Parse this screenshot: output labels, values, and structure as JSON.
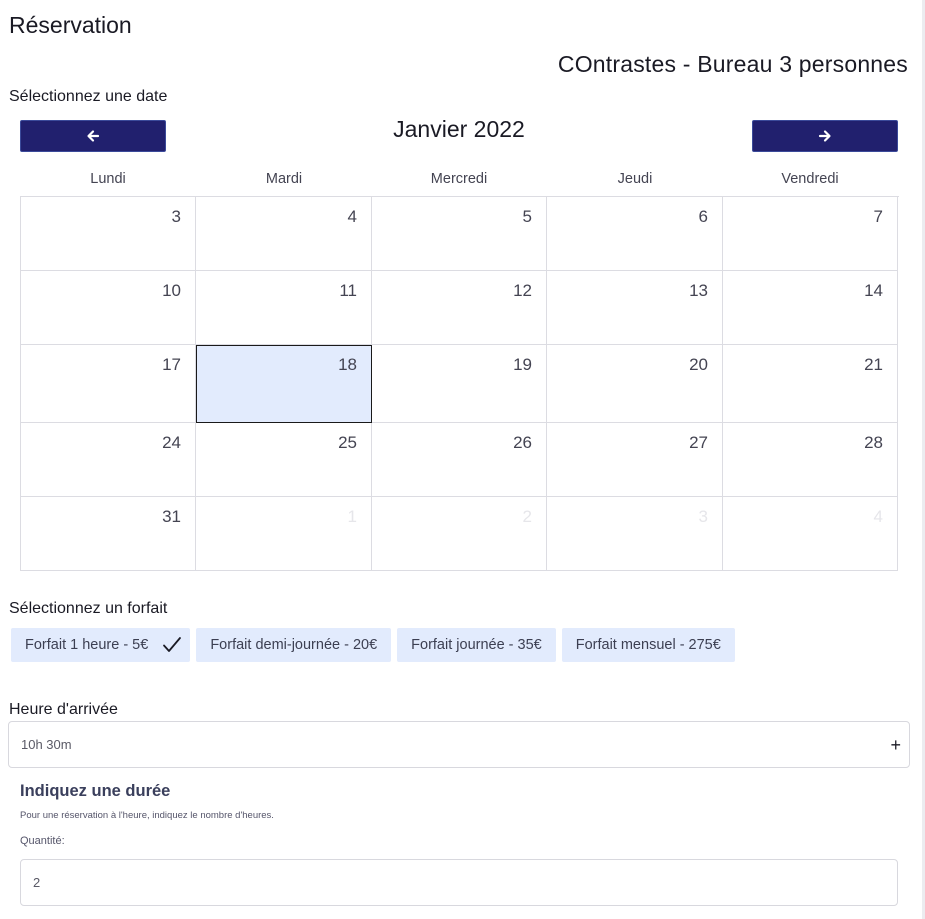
{
  "page": {
    "title": "Réservation",
    "space_name": "COntrastes - Bureau 3 personnes"
  },
  "date_section": {
    "label": "Sélectionnez une date",
    "month_label": "Janvier 2022",
    "prev_icon": "arrow-left-icon",
    "next_icon": "arrow-right-icon",
    "weekdays": [
      "Lundi",
      "Mardi",
      "Mercredi",
      "Jeudi",
      "Vendredi"
    ],
    "selected_day": "18",
    "weeks": [
      {
        "days": [
          {
            "num": "3"
          },
          {
            "num": "4"
          },
          {
            "num": "5"
          },
          {
            "num": "6"
          },
          {
            "num": "7"
          }
        ]
      },
      {
        "days": [
          {
            "num": "10"
          },
          {
            "num": "11"
          },
          {
            "num": "12"
          },
          {
            "num": "13"
          },
          {
            "num": "14"
          }
        ]
      },
      {
        "days": [
          {
            "num": "17"
          },
          {
            "num": "18"
          },
          {
            "num": "19"
          },
          {
            "num": "20"
          },
          {
            "num": "21"
          }
        ]
      },
      {
        "days": [
          {
            "num": "24"
          },
          {
            "num": "25"
          },
          {
            "num": "26"
          },
          {
            "num": "27"
          },
          {
            "num": "28"
          }
        ]
      },
      {
        "days": [
          {
            "num": "31"
          },
          {
            "num": "1",
            "muted": true
          },
          {
            "num": "2",
            "muted": true
          },
          {
            "num": "3",
            "muted": true
          },
          {
            "num": "4",
            "muted": true
          }
        ]
      }
    ]
  },
  "plan_section": {
    "label": "Sélectionnez un forfait",
    "selected_index": 0,
    "plans": [
      {
        "label": "Forfait 1 heure - 5€"
      },
      {
        "label": "Forfait demi-journée - 20€"
      },
      {
        "label": "Forfait journée - 35€"
      },
      {
        "label": "Forfait mensuel - 275€"
      }
    ]
  },
  "arrival": {
    "label": "Heure d'arrivée",
    "value": "10h 30m",
    "expand_symbol": "+"
  },
  "duration": {
    "title": "Indiquez une durée",
    "help": "Pour une réservation à l'heure, indiquez le nombre d'heures.",
    "quantity_label": "Quantité:",
    "quantity_value": "2"
  },
  "colors": {
    "nav_button": "#21206e",
    "selected_bg": "#e2ebfd",
    "plan_bg": "#e2ebfd",
    "border": "#dcdce2"
  }
}
